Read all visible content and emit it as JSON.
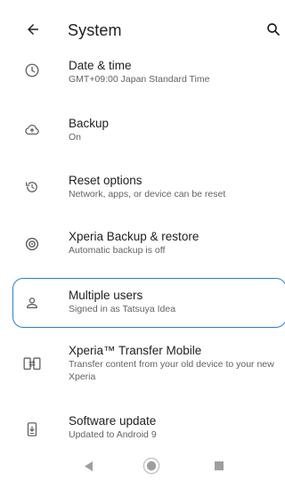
{
  "appbar": {
    "title": "System",
    "back_icon": "arrow-back-icon",
    "search_icon": "search-icon"
  },
  "items": [
    {
      "title": "Date & time",
      "subtitle": "GMT+09:00 Japan Standard Time",
      "icon": "clock-icon"
    },
    {
      "title": "Backup",
      "subtitle": "On",
      "icon": "cloud-backup-icon"
    },
    {
      "title": "Reset options",
      "subtitle": "Network, apps, or device can be reset",
      "icon": "history-icon"
    },
    {
      "title": "Xperia Backup & restore",
      "subtitle": "Automatic backup is off",
      "icon": "backup-restore-icon"
    },
    {
      "title": "Multiple users",
      "subtitle": "Signed in as Tatsuya Idea",
      "icon": "person-icon"
    },
    {
      "title": "Xperia™ Transfer Mobile",
      "subtitle": "Transfer content from your old device to your new Xperia",
      "icon": "transfer-icon"
    },
    {
      "title": "Software update",
      "subtitle": "Updated to Android 9",
      "icon": "system-update-icon"
    }
  ],
  "navbar": {
    "back_icon": "nav-back-icon",
    "home_icon": "nav-home-icon",
    "recents_icon": "nav-recents-icon"
  },
  "colors": {
    "highlight": "#2a7fd4",
    "icon_gray": "#5f6368",
    "nav_gray": "#9e9e9e"
  }
}
